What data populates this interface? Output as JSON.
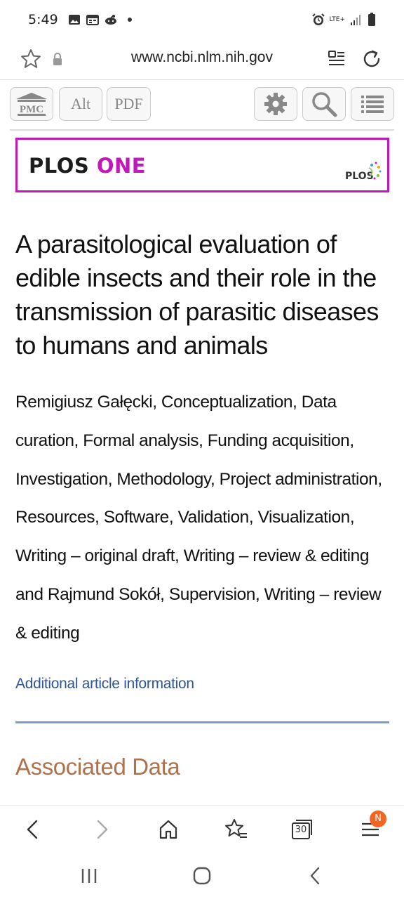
{
  "status_bar": {
    "time": "5:49",
    "icons": [
      "image-icon",
      "calendar-icon",
      "reddit-icon",
      "dot-icon"
    ],
    "right_icons": [
      "alarm-icon",
      "lte-icon",
      "signal-icon",
      "battery-icon"
    ],
    "network": "LTE+"
  },
  "url_bar": {
    "url": "www.ncbi.nlm.nih.gov"
  },
  "pmc_toolbar": {
    "pmc_label": "PMC",
    "alt_label": "Alt",
    "pdf_label": "PDF"
  },
  "banner": {
    "journal_word1": "PLOS",
    "journal_word2": "ONE",
    "logo_text": "PLOS",
    "colors": {
      "accent": "#c318b9"
    }
  },
  "article": {
    "title": "A parasitological evaluation of edible insects and their role in the transmission of parasitic diseases to humans and animals",
    "authors": "Remigiusz Gałęcki, Conceptualization, Data curation, Formal analysis, Funding acquisition, Investigation, Methodology, Project administration, Resources, Software, Validation, Visualization, Writing – original draft, Writing – review & editing and Rajmund Sokół, Supervision, Writing – review & editing",
    "more_info_link": "Additional article information",
    "associated_data_heading": "Associated Data",
    "colors": {
      "link": "#2f5597",
      "heading": "#b0704a",
      "rule": "#7a9ec9"
    }
  },
  "browser_nav": {
    "tab_count": "30",
    "menu_badge": "N"
  }
}
